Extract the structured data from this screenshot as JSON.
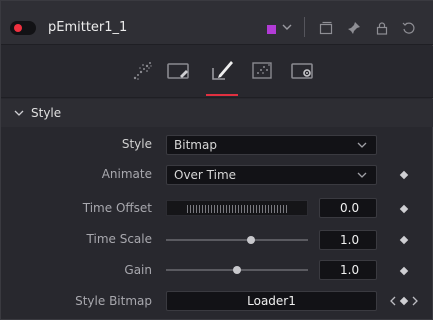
{
  "header": {
    "tool_name": "pEmitter1_1",
    "power_color": "#f0303f",
    "tile_color": "#b23bd6",
    "icons": [
      "color-chevron-icon",
      "versions-icon",
      "pin-icon",
      "lock-icon",
      "reset-icon"
    ]
  },
  "tabs": [
    {
      "name": "tab-controls",
      "icon": "particles-icon"
    },
    {
      "name": "tab-region",
      "icon": "region-icon"
    },
    {
      "name": "tab-style",
      "icon": "brush-icon",
      "active": true
    },
    {
      "name": "tab-sets",
      "icon": "sets-icon"
    },
    {
      "name": "tab-settings",
      "icon": "settings-icon"
    }
  ],
  "accent_color": "#e03040",
  "section": {
    "title": "Style",
    "expanded": true
  },
  "controls": {
    "style": {
      "label": "Style",
      "value": "Bitmap"
    },
    "animate": {
      "label": "Animate",
      "value": "Over Time"
    },
    "time_offset": {
      "label": "Time Offset",
      "value": "0.0"
    },
    "time_scale": {
      "label": "Time Scale",
      "value": "1.0",
      "slider_fraction": 0.6
    },
    "gain": {
      "label": "Gain",
      "value": "1.0",
      "slider_fraction": 0.5
    },
    "style_bitmap": {
      "label": "Style Bitmap",
      "value": "Loader1"
    }
  }
}
